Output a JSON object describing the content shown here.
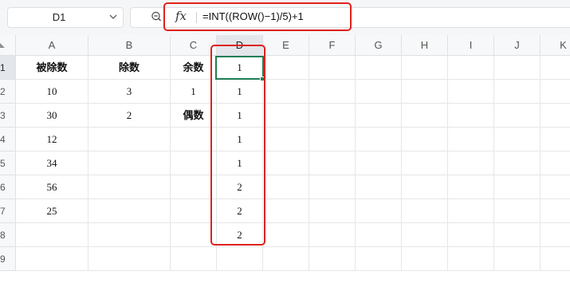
{
  "namebox": {
    "value": "D1",
    "icon": "chevron-down-icon"
  },
  "formula_bar": {
    "fx": "fx",
    "formula": "=INT((ROW()−1)/5)+1",
    "zoom_icon": "zoom-icon"
  },
  "columns": [
    "A",
    "B",
    "C",
    "D",
    "E",
    "F",
    "G",
    "H",
    "I",
    "J",
    "K"
  ],
  "active_column": "D",
  "active_row": "1",
  "rows": [
    "1",
    "2",
    "3",
    "4",
    "5",
    "6",
    "7",
    "8",
    "9"
  ],
  "cells": {
    "A1": "被除数",
    "B1": "除数",
    "C1": "余数",
    "D1": "1",
    "A2": "10",
    "B2": "3",
    "C2": "1",
    "D2": "1",
    "A3": "30",
    "B3": "2",
    "C3": "偶数",
    "D3": "1",
    "A4": "12",
    "D4": "1",
    "A5": "34",
    "D5": "1",
    "A6": "56",
    "D6": "2",
    "A7": "25",
    "D7": "2",
    "D8": "2"
  },
  "highlight_color": "#e0211b",
  "selection_color": "#1e7e55"
}
